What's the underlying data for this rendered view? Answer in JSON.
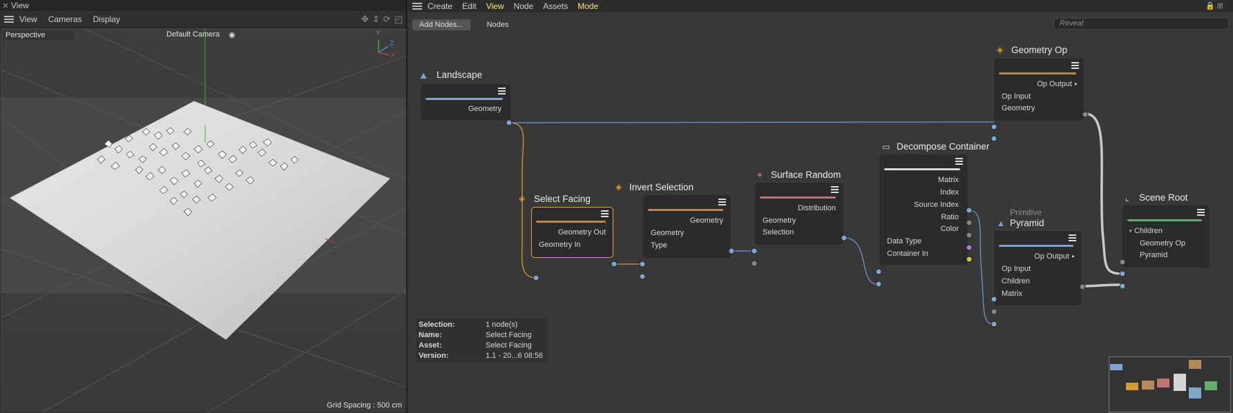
{
  "viewport": {
    "title": "View",
    "menu": [
      "View",
      "Cameras",
      "Display"
    ],
    "projection": "Perspective",
    "camera": "Default Camera",
    "grid_spacing": "Grid Spacing : 500 cm",
    "axis": {
      "y": "Y",
      "z": "Z",
      "x": "X"
    }
  },
  "node_editor": {
    "menu": [
      "Create",
      "Edit",
      "View",
      "Node",
      "Assets",
      "Mode"
    ],
    "active_menus": [
      "View",
      "Mode"
    ],
    "add_nodes": "Add Nodes...",
    "nodes_tab": "Nodes",
    "reveal_placeholder": "Reveal",
    "nodes": {
      "landscape": {
        "title": "Landscape",
        "ports": [
          "Geometry"
        ],
        "color": "#7fa6cf"
      },
      "select_facing": {
        "title": "Select Facing",
        "ports": [
          "Geometry Out",
          "Geometry In"
        ],
        "color": "#b38a58"
      },
      "invert_selection": {
        "title": "Invert Selection",
        "ports": [
          "Geometry",
          "Geometry",
          "Type"
        ],
        "color": "#b38a58"
      },
      "surface_random": {
        "title": "Surface Random",
        "ports": [
          "Distribution",
          "Geometry",
          "Selection"
        ],
        "color": "#c07272"
      },
      "decompose_container": {
        "title": "Decompose Container",
        "ports": [
          "Matrix",
          "Index",
          "Source Index",
          "Ratio",
          "Color",
          "Data Type",
          "Container In"
        ],
        "color": "#d6d6d6"
      },
      "geometry_op": {
        "title": "Geometry Op",
        "ports": [
          "Op Output",
          "Op Input",
          "Geometry"
        ],
        "color": "#b38a58"
      },
      "pyramid": {
        "subtitle": "Primitive",
        "title": "Pyramid",
        "ports": [
          "Op Output",
          "Op Input",
          "Children",
          "Matrix"
        ],
        "color": "#7fa6cf"
      },
      "scene_root": {
        "title": "Scene Root",
        "ports": [
          "Children",
          "Geometry Op",
          "Pyramid"
        ],
        "color": "#62b06a"
      }
    },
    "info": [
      {
        "key": "Selection:",
        "value": "1 node(s)"
      },
      {
        "key": "Name:",
        "value": "Select Facing"
      },
      {
        "key": "Asset:",
        "value": "Select Facing"
      },
      {
        "key": "Version:",
        "value": "1.1 - 20...6 08:56"
      }
    ],
    "port_colors": {
      "geometry": "#7fa6cf",
      "ratio": "#a77ad6",
      "color": "#d8c04a",
      "grey": "#888888"
    },
    "link_colors": {
      "geometry": "#6f94c0",
      "selection": "#d49a3a",
      "op": "#c9c9c9"
    }
  }
}
